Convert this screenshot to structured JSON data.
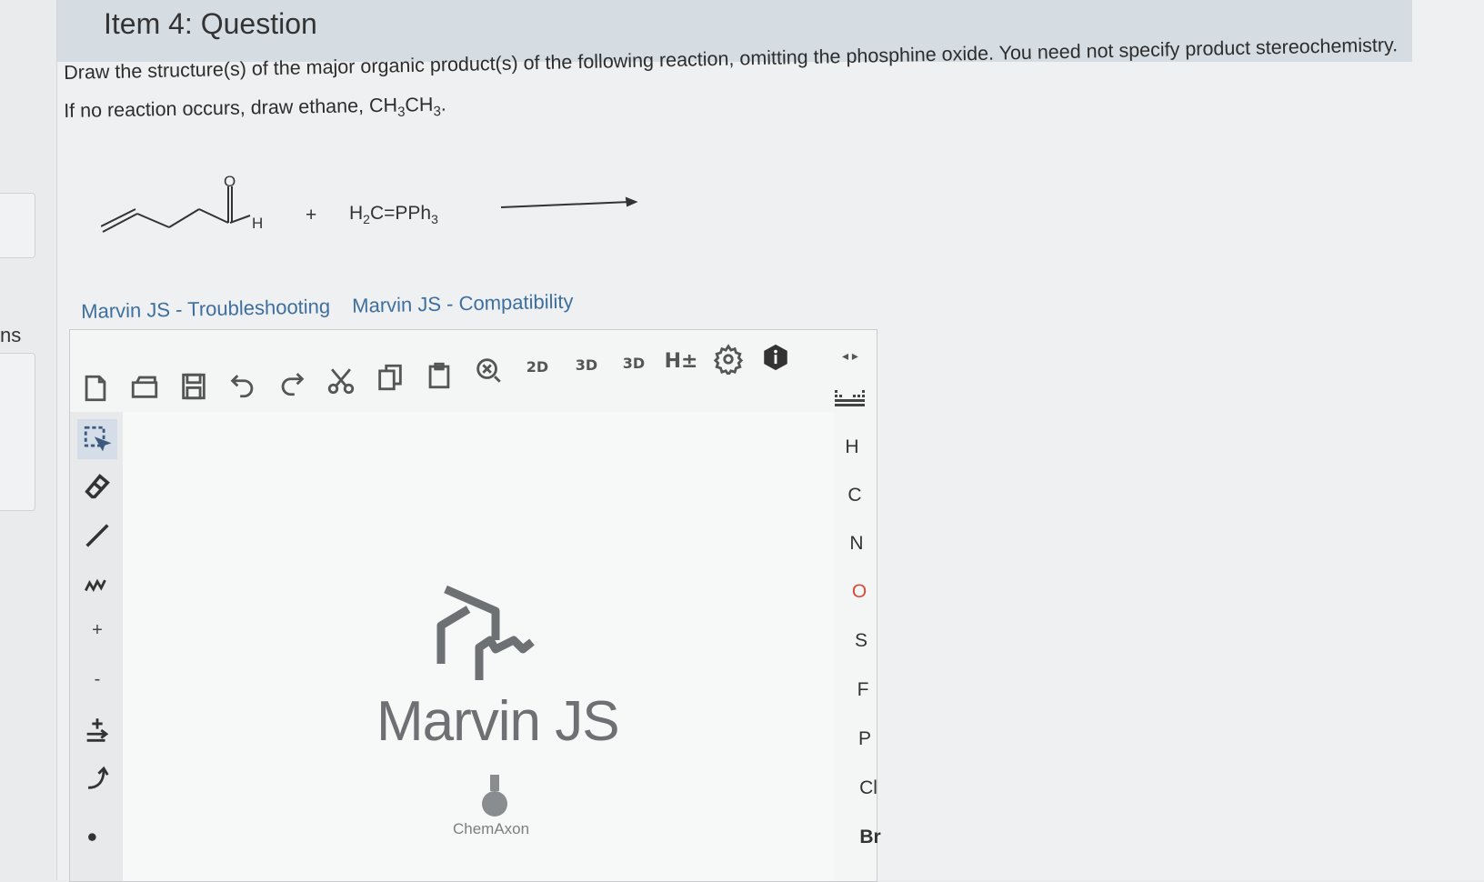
{
  "sidebar": {
    "partial_label": "ns"
  },
  "header": {
    "title": "Item 4: Question"
  },
  "question": {
    "line1": "Draw the structure(s) of the major organic product(s) of the following reaction, omitting the phosphine oxide. You need not specify product stereochemistry.",
    "line2_prefix": "If no reaction occurs, draw ethane, CH",
    "line2_sub1": "3",
    "line2_mid": "CH",
    "line2_sub2": "3",
    "line2_suffix": "."
  },
  "reaction": {
    "aldehyde_o_label": "O",
    "aldehyde_h_label": "H",
    "plus": "+",
    "reagent": "H",
    "reagent_sub": "2",
    "reagent_rest": "C=PPh",
    "reagent_sub2": "3"
  },
  "links": {
    "troubleshooting": "Marvin JS - Troubleshooting",
    "compatibility": "Marvin JS - Compatibility"
  },
  "toolbar": {
    "clean2d": "2D",
    "clean3d": "3D",
    "view3d": "3D",
    "hydrogens": "H±"
  },
  "leftbar": {
    "charge_plus": "+",
    "charge_minus": "-"
  },
  "elements": [
    "H",
    "C",
    "N",
    "O",
    "S",
    "F",
    "P",
    "Cl",
    "Br"
  ],
  "splash": {
    "title": "Marvin JS",
    "vendor": "ChemAxon"
  },
  "colors": {
    "link": "#3e6f9e",
    "oxygen": "#d94a3a",
    "header": "#d5dde3"
  }
}
